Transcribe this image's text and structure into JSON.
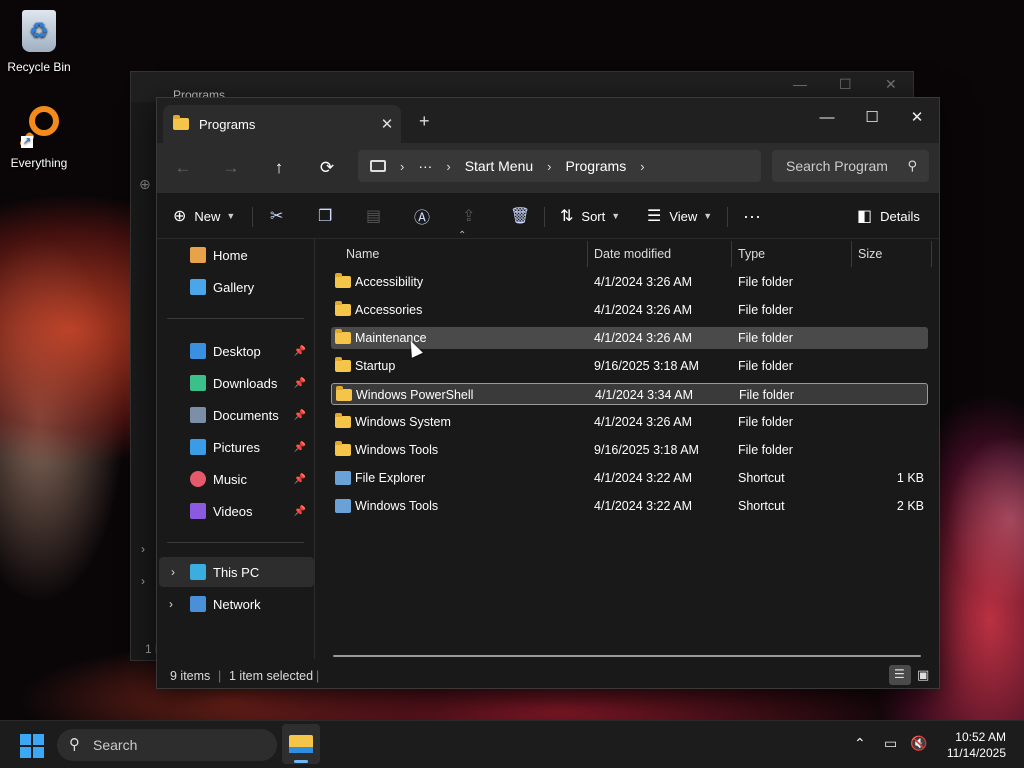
{
  "desktop": {
    "icons": [
      {
        "label": "Recycle Bin"
      },
      {
        "label": "Everything"
      }
    ]
  },
  "background_window": {
    "tab_title": "Programs",
    "footer_fragment": "1 i"
  },
  "window": {
    "tab_title": "Programs",
    "tab_close": "✕",
    "new_tab": "+",
    "controls": {
      "minimize": "—",
      "maximize": "☐",
      "close": "✕"
    }
  },
  "nav": {
    "back": "←",
    "forward": "→",
    "up": "↑",
    "refresh": "⟳",
    "breadcrumb": [
      "Start Menu",
      "Programs"
    ],
    "more": "···",
    "search_placeholder": "Search Program"
  },
  "commands": {
    "new": "New",
    "sort": "Sort",
    "view": "View",
    "more": "···",
    "details": "Details"
  },
  "sidebar": {
    "quick": [
      {
        "label": "Home",
        "color": "#e8a24a"
      },
      {
        "label": "Gallery",
        "color": "#4aa6e8"
      }
    ],
    "pinned": [
      {
        "label": "Desktop",
        "color": "#3b8fe0"
      },
      {
        "label": "Downloads",
        "color": "#3bc08a"
      },
      {
        "label": "Documents",
        "color": "#7c8fa8"
      },
      {
        "label": "Pictures",
        "color": "#3a9be6"
      },
      {
        "label": "Music",
        "color": "#e45a6a"
      },
      {
        "label": "Videos",
        "color": "#8a5ae0"
      }
    ],
    "tree": [
      {
        "label": "This PC"
      },
      {
        "label": "Network"
      }
    ]
  },
  "columns": {
    "name": "Name",
    "date": "Date modified",
    "type": "Type",
    "size": "Size"
  },
  "files": [
    {
      "name": "Accessibility",
      "date": "4/1/2024 3:26 AM",
      "type": "File folder",
      "size": "",
      "kind": "folder"
    },
    {
      "name": "Accessories",
      "date": "4/1/2024 3:26 AM",
      "type": "File folder",
      "size": "",
      "kind": "folder"
    },
    {
      "name": "Maintenance",
      "date": "4/1/2024 3:26 AM",
      "type": "File folder",
      "size": "",
      "kind": "folder"
    },
    {
      "name": "Startup",
      "date": "9/16/2025 3:18 AM",
      "type": "File folder",
      "size": "",
      "kind": "folder"
    },
    {
      "name": "Windows PowerShell",
      "date": "4/1/2024 3:34 AM",
      "type": "File folder",
      "size": "",
      "kind": "folder"
    },
    {
      "name": "Windows System",
      "date": "4/1/2024 3:26 AM",
      "type": "File folder",
      "size": "",
      "kind": "folder"
    },
    {
      "name": "Windows Tools",
      "date": "9/16/2025 3:18 AM",
      "type": "File folder",
      "size": "",
      "kind": "folder"
    },
    {
      "name": "File Explorer",
      "date": "4/1/2024 3:22 AM",
      "type": "Shortcut",
      "size": "1 KB",
      "kind": "shortcut"
    },
    {
      "name": "Windows Tools",
      "date": "4/1/2024 3:22 AM",
      "type": "Shortcut",
      "size": "2 KB",
      "kind": "shortcut"
    }
  ],
  "status": {
    "items": "9 items",
    "selected": "1 item selected",
    "sep": "|"
  },
  "taskbar": {
    "search": "Search",
    "time": "10:52 AM",
    "date": "11/14/2025"
  }
}
